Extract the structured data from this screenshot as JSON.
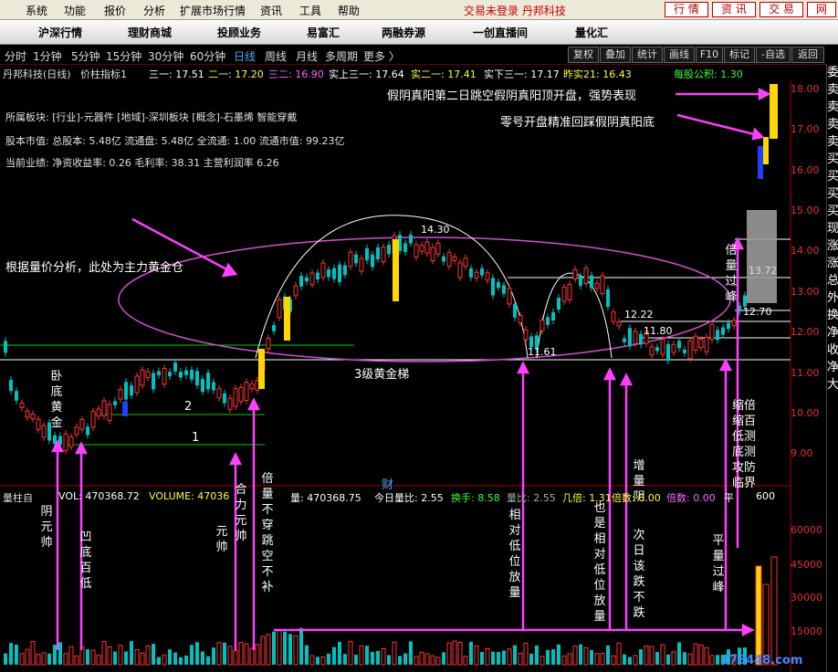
{
  "menubar": {
    "items": [
      "系统",
      "功能",
      "报价",
      "分析",
      "扩展市场行情",
      "资讯",
      "工具",
      "帮助"
    ],
    "status": "交易未登录  丹邦科技",
    "buttons": [
      "行 情",
      "资 讯",
      "交 易",
      "网"
    ]
  },
  "navbar": {
    "items": [
      "沪深行情",
      "理财商城",
      "投顾业务",
      "易富汇",
      "两融券源",
      "一创直播间",
      "量化汇"
    ]
  },
  "periods": [
    "分时",
    "1分钟",
    "5分钟",
    "15分钟",
    "30分钟",
    "60分钟",
    "日线",
    "周线",
    "月线",
    "多周期",
    "更多 〉"
  ],
  "active_period": "日线",
  "tools": [
    "复权",
    "叠加",
    "统计",
    "画线",
    "F10",
    "标记",
    "-自选",
    "返回"
  ],
  "indicator_bar": {
    "title": "丹邦科技(日线)",
    "indicator": "价柱指标1",
    "values": [
      "三一: 17.51",
      "二一: 17.20",
      "三二: 16.90",
      "实上三一: 17.64",
      "实二一: 17.41",
      "实下三一: 17.17",
      "昨实21: 16.43"
    ],
    "eps": "每股公积: 1.30"
  },
  "stock_info": {
    "sector": "所属板块: [行业]-元器件 [地域]-深圳板块 [概念]-石墨烯 智能穿戴",
    "capital": "股本市值: 总股本: 5.48亿 流通盘: 5.48亿 全流通: 1.00 流通市值: 99.23亿",
    "perf": "当前业绩: 净资收益率: 0.26 毛利率: 38.31 主营利润率 6.26"
  },
  "annotations": {
    "top1": "假阴真阳第二日跳空假阴真阳顶开盘，强势表现",
    "top2": "零号开盘精准回踩假阴真阳底",
    "main_force": "根据量价分析，此处为主力黄金仓",
    "ladder": "3级黄金梯",
    "v_wodi": "卧底黄金",
    "v_yinyuanshuai": "阴元帅",
    "v_aodi": "凹底百低",
    "v_yuanshuai": "元帅",
    "v_hefa": "合力元帅",
    "v_beiliang": "倍量不穿跳空不补",
    "v_xiangdui": "相对低位放量",
    "v_yeshi": "也是相对低位放量",
    "v_zengliang": "增量阴",
    "v_ciri": "次日该跌不跌",
    "v_pingliang": "平量过峰",
    "v_suobei": "缩倍缩百低测底测攻防临界",
    "v_beiliangguofeng": "倍量过峰",
    "lbl_1": "1",
    "lbl_2": "2",
    "lbl_1430": "14.30",
    "lbl_1222": "12.22",
    "lbl_1180": "11.80",
    "lbl_1161": "11.61",
    "lbl_1372": "13.72",
    "lbl_1270": "12.70",
    "cai": "财"
  },
  "price_axis": [
    "18.00",
    "17.00",
    "16.00",
    "15.00",
    "14.00",
    "13.00",
    "12.00",
    "11.00",
    "10.00",
    "9.00"
  ],
  "volume_bar": {
    "label": "量柱自",
    "vol": "VOL: 470368.72",
    "volume": "VOLUME: 47036",
    "liang": "量: 470368.75",
    "ratio": "今日量比: 2.55",
    "turnover": "换手: 8.58",
    "liangbi": "量比: 2.55",
    "jibei": "几倍: 1.31",
    "beishu": "倍数: 0.00",
    "ping": "平",
    "value_600": "600"
  },
  "volume_axis": [
    "60000",
    "45000",
    "30000",
    "15000"
  ],
  "watermark": "178448.com",
  "side_column": [
    "委",
    "卖",
    "卖",
    "卖",
    "卖",
    "买",
    "买",
    "买",
    "买",
    "现",
    "涨",
    "涨",
    "总",
    "外",
    "换",
    "净",
    "收",
    "净",
    "大"
  ],
  "colors": {
    "up": "#ff3333",
    "down": "#00c0c0",
    "gold": "#ffd700",
    "arrow": "#ff40ff",
    "ellipse": "#d050d0"
  }
}
